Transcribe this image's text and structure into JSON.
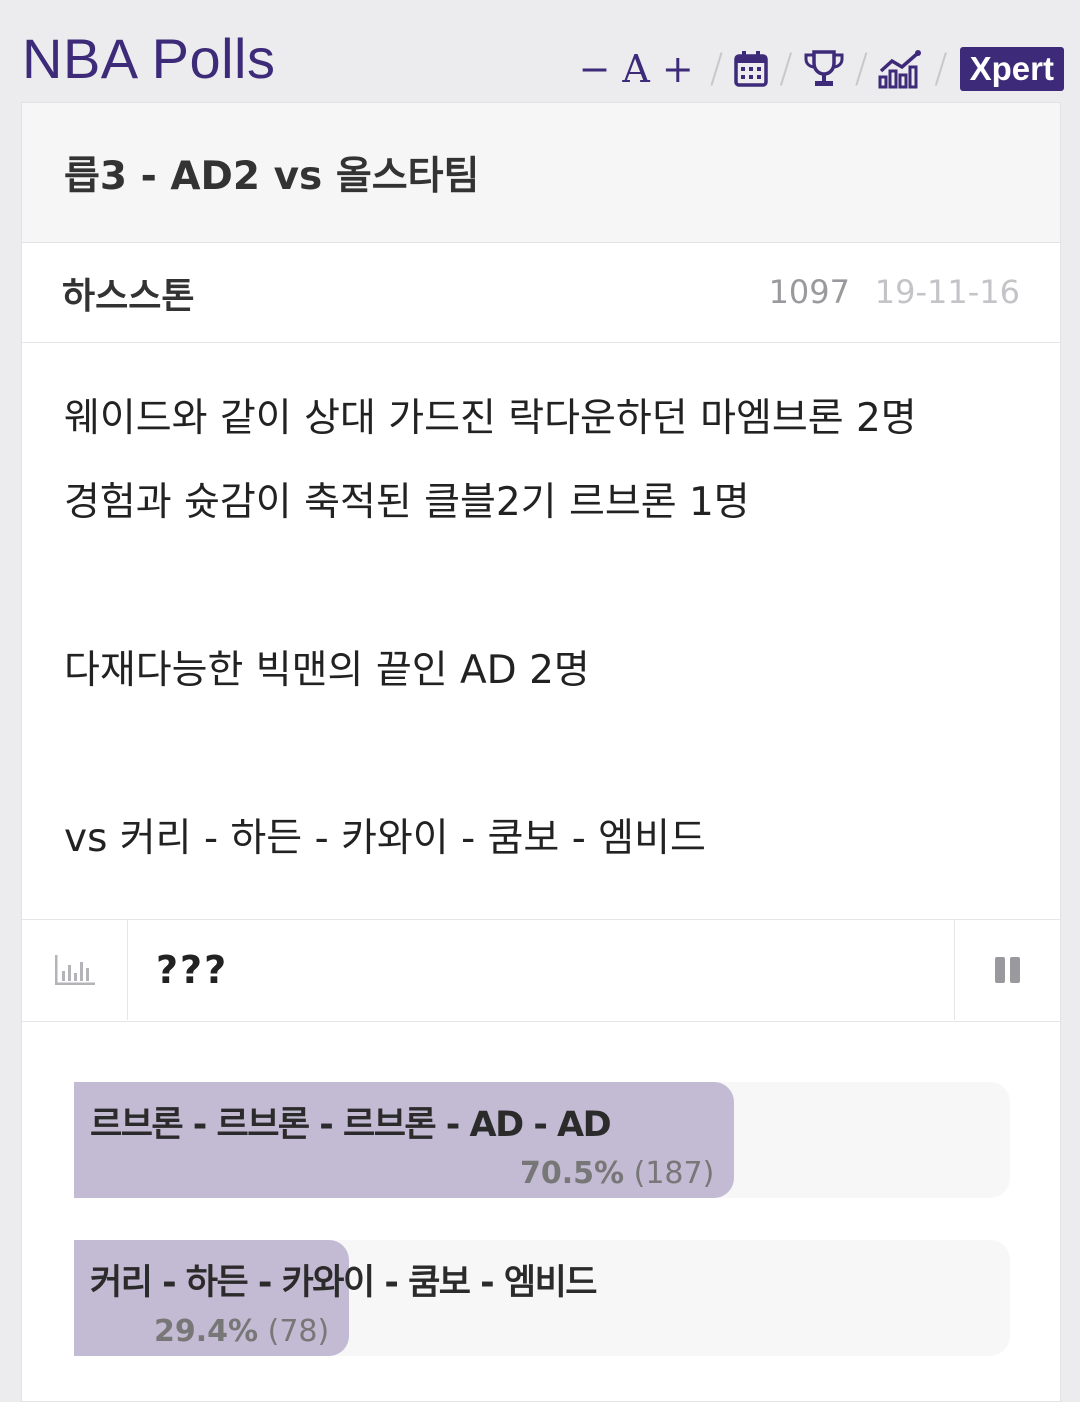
{
  "app": {
    "title": "NBA Polls"
  },
  "toolbar": {
    "font_decrease": "−",
    "font_label": "A",
    "font_increase": "+",
    "separator": "/",
    "xpert_label": "Xpert",
    "icons": [
      "calendar-icon",
      "trophy-icon",
      "stats-chart-icon"
    ]
  },
  "post": {
    "title": "릅3 - AD2 vs 올스타팀",
    "author": "하스스톤",
    "views": "1097",
    "date": "19-11-16",
    "body": [
      "웨이드와 같이 상대 가드진 락다운하던 마엠브론 2명",
      "경험과 슛감이 축적된 클블2기 르브론 1명",
      "",
      "다재다능한 빅맨의 끝인 AD 2명",
      "",
      "vs 커리 - 하든 - 카와이 - 쿰보 - 엠비드"
    ]
  },
  "poll": {
    "question": "???",
    "options": [
      {
        "label": "르브론 - 르브론 - 르브론 - AD - AD",
        "percent": "70.5%",
        "count": "(187)",
        "fraction": 0.705
      },
      {
        "label": "커리 - 하든 - 카와이 - 쿰보 - 엠비드",
        "percent": "29.4%",
        "count": "(78)",
        "fraction": 0.294
      }
    ]
  },
  "colors": {
    "brand": "#3d2a78",
    "bar_fill": "#c3bad3",
    "bar_track": "#f7f7f8"
  }
}
